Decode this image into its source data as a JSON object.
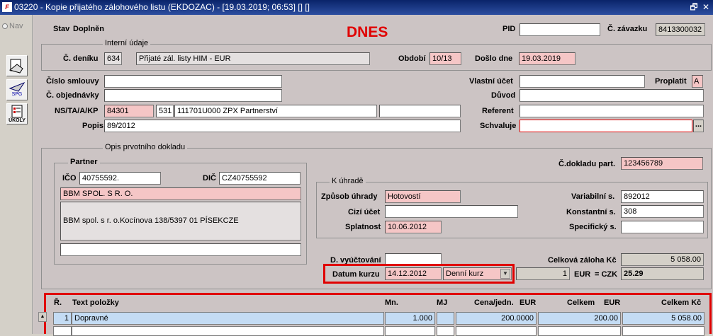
{
  "window": {
    "title": "03220 - Kopie přijatého zálohového listu (EKDOZAC) - [19.03.2019; 06:53] [] []",
    "app_icon": "F",
    "restore": "🗗",
    "close": "✕"
  },
  "side": {
    "nav_label": "Nav",
    "spg_label": "SPG",
    "ukoly_label": "ÚKOLY"
  },
  "header": {
    "stav_label": "Stav",
    "stav_value": "Doplněn",
    "dnes": "DNES",
    "pid_label": "PID",
    "pid_value": "",
    "zavazku_label": "Č. závazku",
    "zavazku_value": "8413300032"
  },
  "interni": {
    "group_title": "Interní údaje",
    "denik_label": "Č. deníku",
    "denik_value": "634",
    "denik_name": "Přijaté zál. listy HIM - EUR",
    "obdobi_label": "Období",
    "obdobi_value": "10/13",
    "doslo_label": "Došlo dne",
    "doslo_value": "19.03.2019"
  },
  "left_fields": {
    "smlouvy_label": "Číslo smlouvy",
    "smlouvy_value": "",
    "objednavky_label": "Č. objednávky",
    "objednavky_value": "",
    "ns_label": "NS/TA/A/KP",
    "ns_value": "84301",
    "ta_value": "531",
    "a_value": "111701U000 ZPX Partnerství",
    "kp_value": "",
    "popis_label": "Popis",
    "popis_value": "89/2012"
  },
  "right_fields": {
    "vlastni_label": "Vlastní účet",
    "vlastni_value": "",
    "proplatit_label": "Proplatit",
    "proplatit_value": "A",
    "duvod_label": "Důvod",
    "duvod_value": "",
    "referent_label": "Referent",
    "referent_value": "",
    "schvaluje_label": "Schvaluje",
    "schvaluje_value": "",
    "ellipsis": "..."
  },
  "opis": {
    "group_title": "Opis prvotního dokladu",
    "partner_title": "Partner",
    "ico_label": "IČO",
    "ico_value": "40755592.",
    "dic_label": "DIČ",
    "dic_value": "CZ40755592",
    "partner_name": "BBM SPOL. S R. O.",
    "partner_address": "BBM spol. s r. o.Kocínova 138/5397 01 PÍSEKCZE",
    "partner_extra": "",
    "cdokladu_label": "Č.dokladu part.",
    "cdokladu_value": "123456789"
  },
  "uhrada": {
    "group_title": "K úhradě",
    "zpusob_label": "Způsob úhrady",
    "zpusob_value": "Hotovostí",
    "cizi_label": "Cizí účet",
    "cizi_value": "",
    "splatnost_label": "Splatnost",
    "splatnost_value": "10.06.2012",
    "var_label": "Variabilní s.",
    "var_value": "892012",
    "konst_label": "Konstantní s.",
    "konst_value": "308",
    "spec_label": "Specifický s.",
    "spec_value": ""
  },
  "kurz": {
    "vyuct_label": "D. vyúčtování",
    "vyuct_value": "",
    "datum_label": "Datum kurzu",
    "datum_value": "14.12.2012",
    "typ_value": "Denní kurz",
    "mnozstvi": "1",
    "mena": "EUR",
    "czk_label": "= CZK",
    "czk_value": "25.29",
    "celkova_label": "Celková záloha Kč",
    "celkova_value": "5 058.00"
  },
  "items": {
    "headers": {
      "r": "Ř.",
      "text": "Text položky",
      "mn": "Mn.",
      "mj": "MJ",
      "cena": "Cena/jedn.",
      "cena_cur": "EUR",
      "celkem": "Celkem",
      "celkem_cur": "EUR",
      "celkem_kc": "Celkem Kč"
    },
    "rows": [
      {
        "r": "1",
        "text": "Dopravné",
        "mn": "1.000",
        "mj": "",
        "cena": "200.0000",
        "celkem": "200.00",
        "celkem_kc": "5 058.00"
      }
    ]
  },
  "colors": {
    "pink": "#f5c6c6",
    "accent_red": "#e00000",
    "row_blue": "#c4dcf4"
  }
}
